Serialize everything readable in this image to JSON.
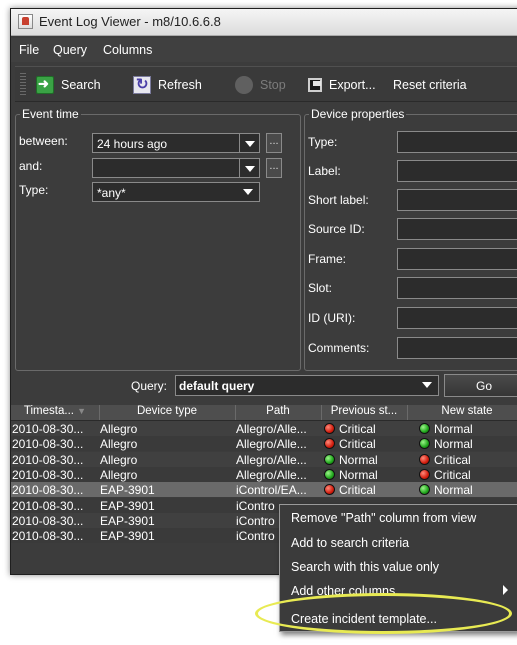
{
  "window": {
    "title": "Event Log Viewer - m8/10.6.6.8"
  },
  "menubar": {
    "items": [
      "File",
      "Query",
      "Columns"
    ]
  },
  "toolbar": {
    "search": "Search",
    "refresh": "Refresh",
    "stop": "Stop",
    "export": "Export...",
    "reset": "Reset criteria"
  },
  "event_time": {
    "legend": "Event time",
    "between_label": "between:",
    "between_value": "24 hours ago",
    "and_label": "and:",
    "and_value": "",
    "type_label": "Type:",
    "type_value": "*any*",
    "dots": "..."
  },
  "device_properties": {
    "legend": "Device properties",
    "labels": [
      "Type:",
      "Label:",
      "Short label:",
      "Source ID:",
      "Frame:",
      "Slot:",
      "ID (URI):",
      "Comments:"
    ]
  },
  "query": {
    "label": "Query:",
    "value": "default query",
    "go": "Go"
  },
  "table": {
    "headers": [
      "Timesta...",
      "Device type",
      "Path",
      "Previous st...",
      "New state"
    ],
    "rows": [
      {
        "timestamp": "2010-08-30...",
        "device_type": "Allegro",
        "path": "Allegro/Alle...",
        "previous_state": "Critical",
        "previous_color": "red",
        "new_state": "Normal",
        "new_color": "green"
      },
      {
        "timestamp": "2010-08-30...",
        "device_type": "Allegro",
        "path": "Allegro/Alle...",
        "previous_state": "Critical",
        "previous_color": "red",
        "new_state": "Normal",
        "new_color": "green"
      },
      {
        "timestamp": "2010-08-30...",
        "device_type": "Allegro",
        "path": "Allegro/Alle...",
        "previous_state": "Normal",
        "previous_color": "green",
        "new_state": "Critical",
        "new_color": "red"
      },
      {
        "timestamp": "2010-08-30...",
        "device_type": "Allegro",
        "path": "Allegro/Alle...",
        "previous_state": "Normal",
        "previous_color": "green",
        "new_state": "Critical",
        "new_color": "red"
      },
      {
        "timestamp": "2010-08-30...",
        "device_type": "EAP-3901",
        "path": "iControl/EA...",
        "previous_state": "Critical",
        "previous_color": "red",
        "new_state": "Normal",
        "new_color": "green"
      },
      {
        "timestamp": "2010-08-30...",
        "device_type": "EAP-3901",
        "path": "iContro",
        "previous_state": "",
        "previous_color": "",
        "new_state": "",
        "new_color": ""
      },
      {
        "timestamp": "2010-08-30...",
        "device_type": "EAP-3901",
        "path": "iContro",
        "previous_state": "",
        "previous_color": "",
        "new_state": "",
        "new_color": ""
      },
      {
        "timestamp": "2010-08-30...",
        "device_type": "EAP-3901",
        "path": "iContro",
        "previous_state": "",
        "previous_color": "",
        "new_state": "",
        "new_color": ""
      }
    ]
  },
  "context_menu": {
    "items": [
      "Remove \"Path\" column from view",
      "Add to search criteria",
      "Search with this value only",
      "Add other columns",
      "Create incident template..."
    ]
  },
  "colors": {
    "highlight": "#e8ea53",
    "background": "#3c3c3c"
  }
}
